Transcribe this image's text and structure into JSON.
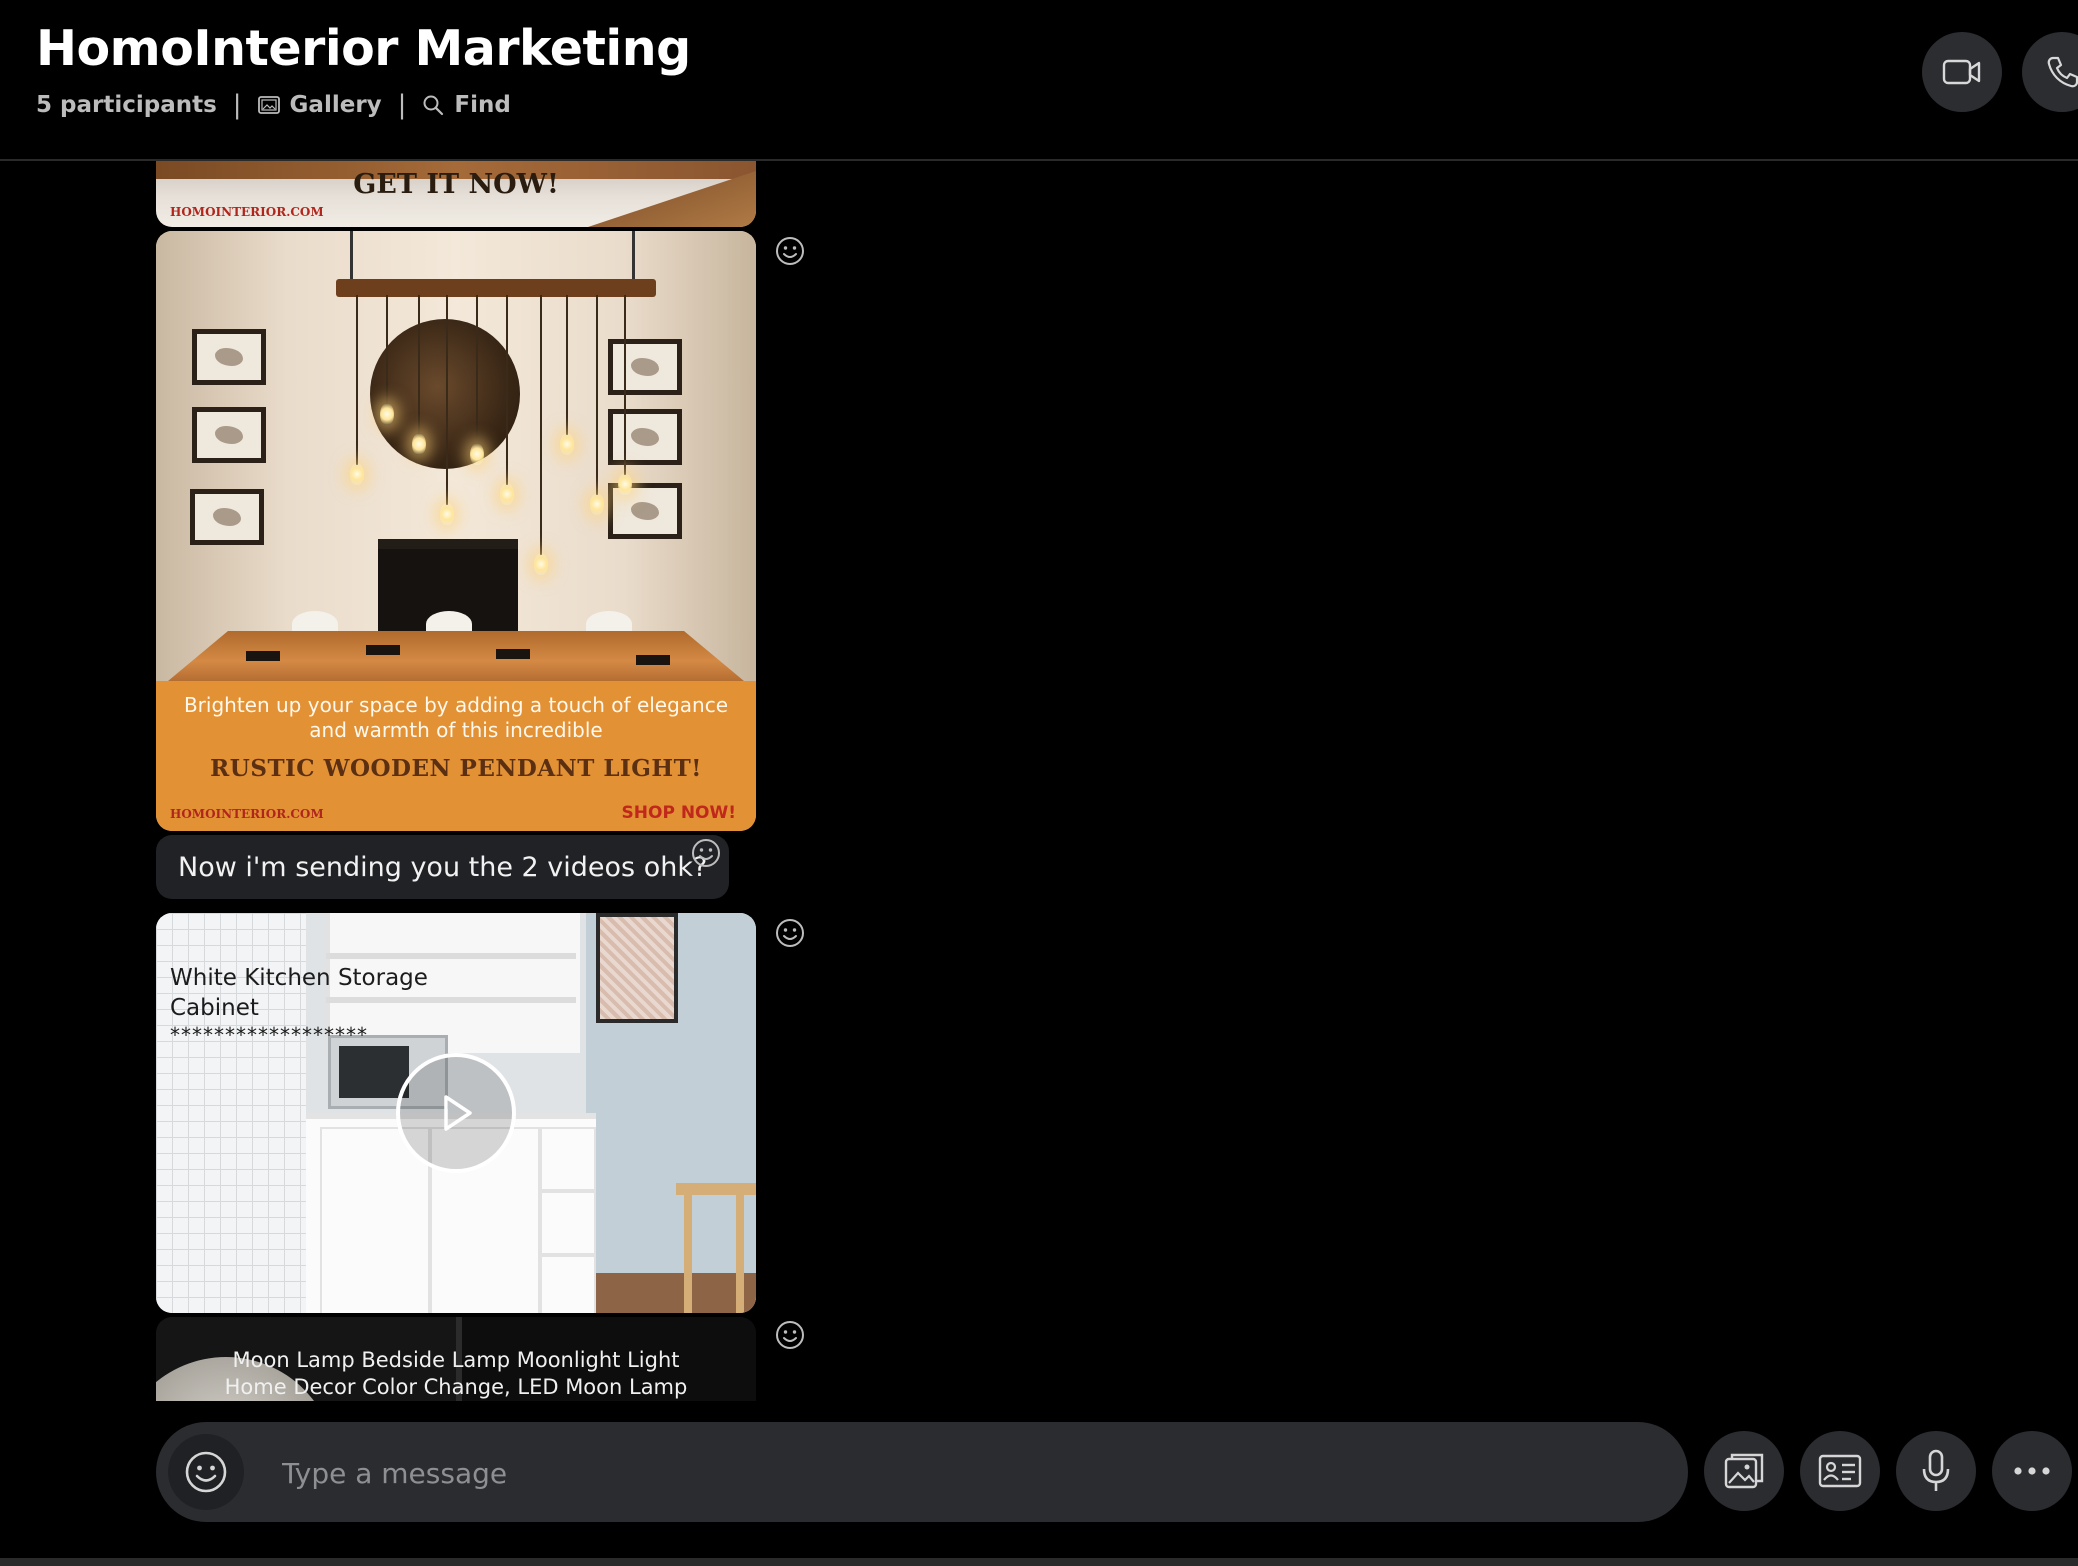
{
  "header": {
    "title": "HomoInterior Marketing",
    "participants": "5 participants",
    "separator": "|",
    "gallery_label": "Gallery",
    "find_label": "Find",
    "icons": [
      "video-call-icon",
      "audio-call-icon"
    ]
  },
  "messages": {
    "ad1": {
      "cta": "GET IT NOW!",
      "site": "HOMOINTERIOR.COM"
    },
    "ad2": {
      "line1": "Brighten up your space by adding a touch of elegance",
      "line2": "and warmth of this incredible",
      "product": "RUSTIC WOODEN PENDANT LIGHT!",
      "site": "HOMOINTERIOR.COM",
      "shop": "SHOP NOW!"
    },
    "text1": "Now i'm sending you the 2 videos ohk?",
    "video1": {
      "line1": "White Kitchen Storage",
      "line2": "Cabinet",
      "stars": "******************"
    },
    "video2": {
      "line1": "Moon Lamp Bedside Lamp Moonlight Light",
      "line2": "Home Decor Color Change, LED Moon Lamp"
    }
  },
  "composer": {
    "placeholder": "Type a message",
    "icons": [
      "emoji-icon",
      "gallery-upload-icon",
      "contact-card-icon",
      "microphone-icon",
      "more-icon"
    ]
  },
  "colors": {
    "background": "#000000",
    "bubble": "#212226",
    "composer": "#2b2c30",
    "muted_text": "#bcbcbc",
    "ad_orange": "#e39135"
  }
}
